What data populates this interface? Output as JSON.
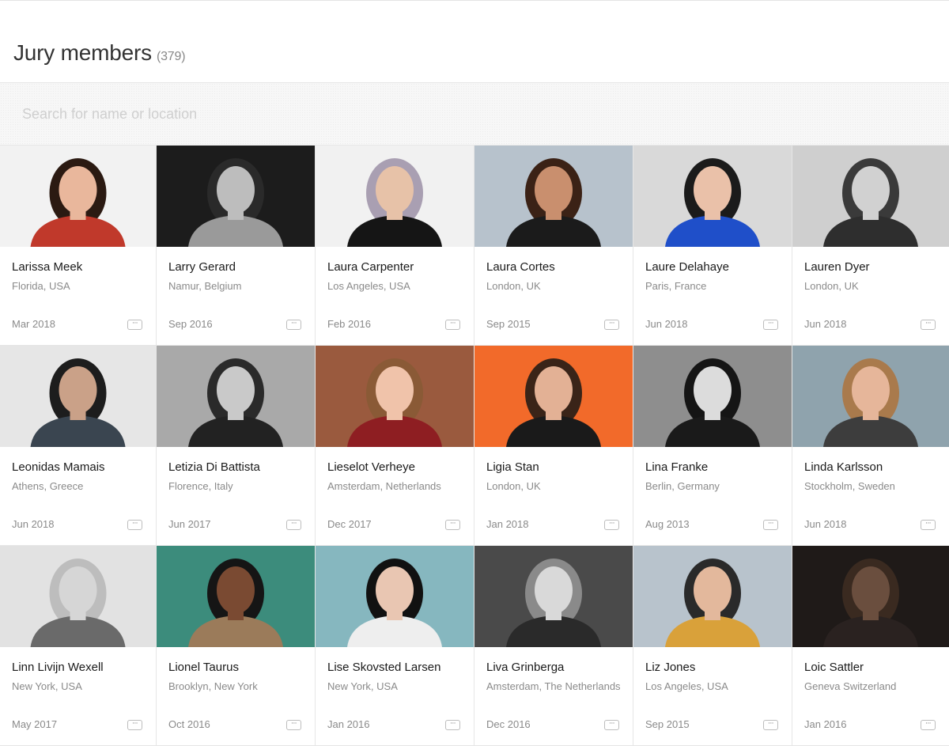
{
  "header": {
    "title": "Jury members",
    "count": "(379)"
  },
  "search": {
    "placeholder": "Search for name or location",
    "value": ""
  },
  "more_label": "···",
  "members": [
    {
      "name": "Larissa Meek",
      "location": "Florida, USA",
      "date": "Mar 2018",
      "bg": "#f2f2f2",
      "skin": "#e9b79c",
      "hair": "#2b1a12",
      "body": "#c0392b",
      "grey": false
    },
    {
      "name": "Larry Gerard",
      "location": "Namur, Belgium",
      "date": "Sep 2016",
      "bg": "#1c1c1c",
      "skin": "#bdbdbd",
      "hair": "#2a2a2a",
      "body": "#9a9a9a",
      "grey": true
    },
    {
      "name": "Laura Carpenter",
      "location": "Los Angeles, USA",
      "date": "Feb 2016",
      "bg": "#f1f1f1",
      "skin": "#e7c2a8",
      "hair": "#a99fb2",
      "body": "#151515",
      "grey": false
    },
    {
      "name": "Laura Cortes",
      "location": "London, UK",
      "date": "Sep 2015",
      "bg": "#b7c2cc",
      "skin": "#c98f6e",
      "hair": "#3b2216",
      "body": "#1b1b1b",
      "grey": false
    },
    {
      "name": "Laure Delahaye",
      "location": "Paris, France",
      "date": "Jun 2018",
      "bg": "#d9d9d9",
      "skin": "#eac1a9",
      "hair": "#1b1b1b",
      "body": "#1f4fc9",
      "grey": false
    },
    {
      "name": "Lauren Dyer",
      "location": "London, UK",
      "date": "Jun 2018",
      "bg": "#cfcfcf",
      "skin": "#d1d1d1",
      "hair": "#3a3a3a",
      "body": "#2e2e2e",
      "grey": true
    },
    {
      "name": "Leonidas Mamais",
      "location": "Athens, Greece",
      "date": "Jun 2018",
      "bg": "#e6e6e6",
      "skin": "#caa188",
      "hair": "#1d1d1d",
      "body": "#3a4550",
      "grey": false
    },
    {
      "name": "Letizia Di Battista",
      "location": "Florence, Italy",
      "date": "Jun 2017",
      "bg": "#a9a9a9",
      "skin": "#c9c9c9",
      "hair": "#2a2a2a",
      "body": "#222222",
      "grey": true
    },
    {
      "name": "Lieselot Verheye",
      "location": "Amsterdam, Netherlands",
      "date": "Dec 2017",
      "bg": "#9a5a3e",
      "skin": "#f0c3aa",
      "hair": "#8a5a36",
      "body": "#8e1e22",
      "grey": false
    },
    {
      "name": "Ligia Stan",
      "location": "London, UK",
      "date": "Jan 2018",
      "bg": "#f26a2a",
      "skin": "#e3b195",
      "hair": "#3a2418",
      "body": "#1a1a1a",
      "grey": false
    },
    {
      "name": "Lina Franke",
      "location": "Berlin, Germany",
      "date": "Aug 2013",
      "bg": "#8e8e8e",
      "skin": "#dcdcdc",
      "hair": "#151515",
      "body": "#1a1a1a",
      "grey": true
    },
    {
      "name": "Linda Karlsson",
      "location": "Stockholm, Sweden",
      "date": "Jun 2018",
      "bg": "#8fa3ad",
      "skin": "#e6b69a",
      "hair": "#a97a4c",
      "body": "#3d3d3d",
      "grey": false
    },
    {
      "name": "Linn Livijn Wexell",
      "location": "New York, USA",
      "date": "May 2017",
      "bg": "#e2e2e2",
      "skin": "#d6d6d6",
      "hair": "#bdbdbd",
      "body": "#6a6a6a",
      "grey": true
    },
    {
      "name": "Lionel Taurus",
      "location": "Brooklyn, New York",
      "date": "Oct 2016",
      "bg": "#3c8c7c",
      "skin": "#7a4a32",
      "hair": "#151515",
      "body": "#9b7b5a",
      "grey": false
    },
    {
      "name": "Lise Skovsted Larsen",
      "location": "New York, USA",
      "date": "Jan 2016",
      "bg": "#86b7bf",
      "skin": "#e9c6b2",
      "hair": "#111111",
      "body": "#eeeeee",
      "grey": false
    },
    {
      "name": "Liva Grinberga",
      "location": "Amsterdam, The Netherlands",
      "date": "Dec 2016",
      "bg": "#4a4a4a",
      "skin": "#d9d9d9",
      "hair": "#8a8a8a",
      "body": "#2a2a2a",
      "grey": true
    },
    {
      "name": "Liz Jones",
      "location": "Los Angeles, USA",
      "date": "Sep 2015",
      "bg": "#b8c3cc",
      "skin": "#e3b89c",
      "hair": "#2a2a2a",
      "body": "#d9a13a",
      "grey": false
    },
    {
      "name": "Loic Sattler",
      "location": "Geneva Switzerland",
      "date": "Jan 2016",
      "bg": "#1f1a18",
      "skin": "#6a4e3e",
      "hair": "#3a2a20",
      "body": "#2a2220",
      "grey": false
    }
  ]
}
